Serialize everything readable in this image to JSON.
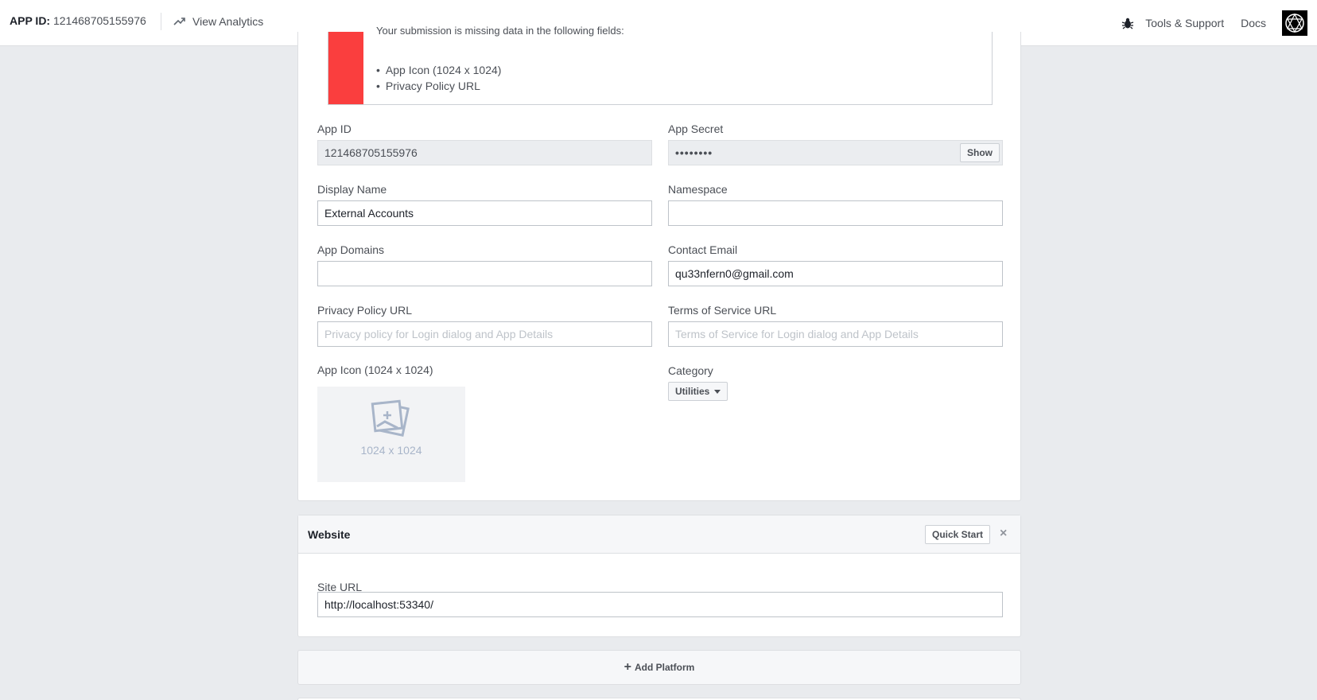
{
  "topbar": {
    "app_id_label": "APP ID:",
    "app_id_value": "121468705155976",
    "view_analytics": "View Analytics",
    "tools_support": "Tools & Support",
    "docs": "Docs"
  },
  "alert": {
    "message": "Your submission is missing data in the following fields:",
    "items": [
      "App Icon (1024 x 1024)",
      "Privacy Policy URL"
    ]
  },
  "form": {
    "app_id": {
      "label": "App ID",
      "value": "121468705155976"
    },
    "app_secret": {
      "label": "App Secret",
      "value": "••••••••",
      "show_button": "Show"
    },
    "display_name": {
      "label": "Display Name",
      "value": "External Accounts"
    },
    "namespace": {
      "label": "Namespace",
      "value": ""
    },
    "app_domains": {
      "label": "App Domains",
      "value": ""
    },
    "contact_email": {
      "label": "Contact Email",
      "value": "qu33nfern0@gmail.com"
    },
    "privacy_policy_url": {
      "label": "Privacy Policy URL",
      "placeholder": "Privacy policy for Login dialog and App Details"
    },
    "terms_of_service_url": {
      "label": "Terms of Service URL",
      "placeholder": "Terms of Service for Login dialog and App Details"
    },
    "app_icon": {
      "label": "App Icon (1024 x 1024)",
      "dimensions": "1024 x 1024"
    },
    "category": {
      "label": "Category",
      "value": "Utilities"
    }
  },
  "website": {
    "title": "Website",
    "quick_start": "Quick Start",
    "close": "×",
    "site_url": {
      "label": "Site URL",
      "value": "http://localhost:53340/"
    }
  },
  "add_platform": {
    "plus": "+",
    "label": "Add Platform"
  },
  "colors": {
    "alert_red": "#fa3e3e",
    "page_bg": "#e9ebee"
  }
}
